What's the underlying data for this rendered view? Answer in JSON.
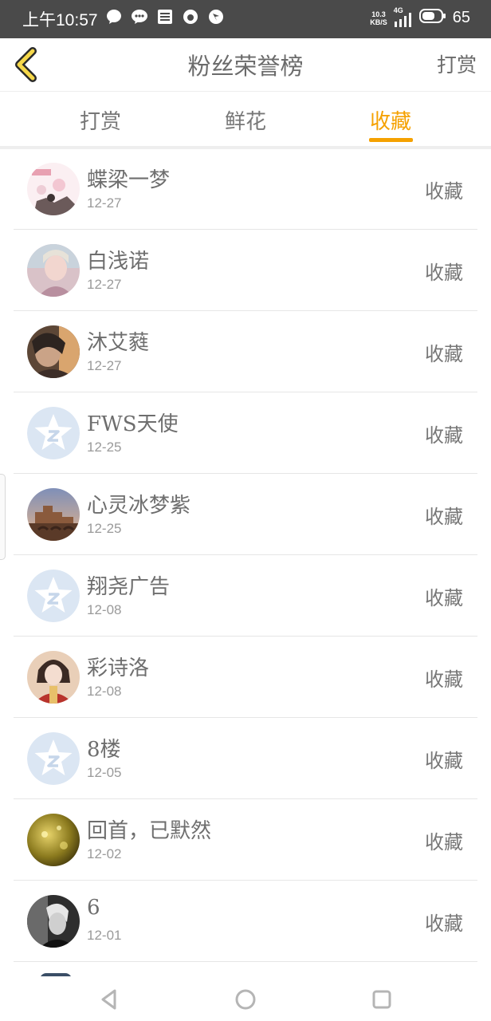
{
  "status_bar": {
    "time": "上午10:57",
    "net_speed_value": "10.3",
    "net_speed_unit": "KB/S",
    "network_type": "4G",
    "battery": "65",
    "notification_icons": [
      "chat-bubble-icon",
      "message-icon",
      "list-icon",
      "app-icon",
      "shield-icon"
    ]
  },
  "header": {
    "title": "粉丝荣誉榜",
    "right_action": "打赏"
  },
  "tabs": [
    {
      "label": "打赏",
      "active": false
    },
    {
      "label": "鲜花",
      "active": false
    },
    {
      "label": "收藏",
      "active": true
    }
  ],
  "accent_color": "#f5a100",
  "fans": [
    {
      "name": "蝶梁一梦",
      "date": "12-27",
      "action": "收藏",
      "avatar": "photo-avatar"
    },
    {
      "name": "白浅诺",
      "date": "12-27",
      "action": "收藏",
      "avatar": "photo-avatar"
    },
    {
      "name": "沐艾蕤",
      "date": "12-27",
      "action": "收藏",
      "avatar": "photo-avatar"
    },
    {
      "name": "FWS天使",
      "date": "12-25",
      "action": "收藏",
      "avatar": "default-star-avatar"
    },
    {
      "name": "心灵冰梦紫",
      "date": "12-25",
      "action": "收藏",
      "avatar": "photo-avatar"
    },
    {
      "name": "翔尧广告",
      "date": "12-08",
      "action": "收藏",
      "avatar": "default-star-avatar"
    },
    {
      "name": "彩诗洛",
      "date": "12-08",
      "action": "收藏",
      "avatar": "photo-avatar"
    },
    {
      "name": "8楼",
      "date": "12-05",
      "action": "收藏",
      "avatar": "default-star-avatar"
    },
    {
      "name": "回首，已默然",
      "date": "12-02",
      "action": "收藏",
      "avatar": "photo-avatar"
    },
    {
      "name": "6",
      "date": "12-01",
      "action": "收藏",
      "avatar": "photo-avatar"
    }
  ]
}
